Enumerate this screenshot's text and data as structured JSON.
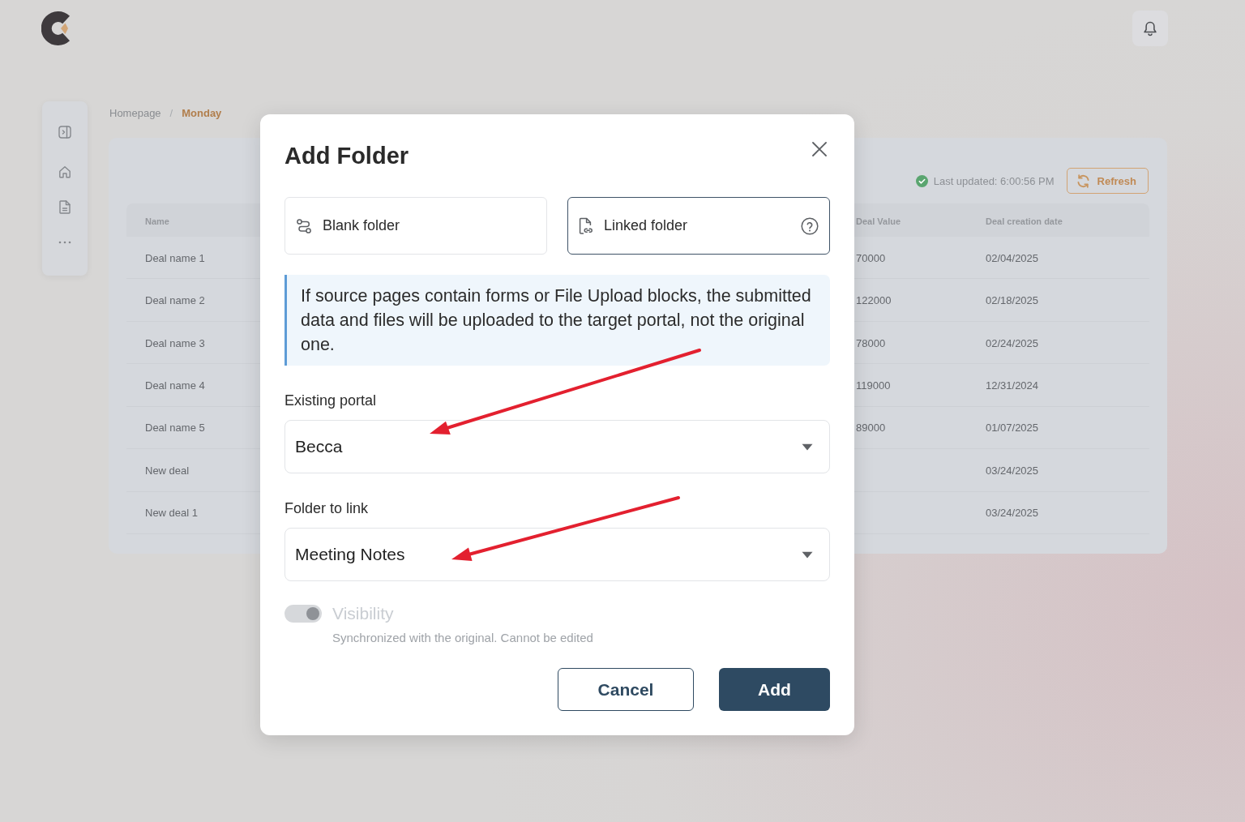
{
  "breadcrumb": {
    "separator": "/",
    "items": [
      {
        "label": "Homepage",
        "selected": false
      },
      {
        "label": "Monday",
        "selected": true
      }
    ]
  },
  "deals": {
    "last_updated": "Last updated: 6:00:56 PM",
    "refresh_button": "Refresh",
    "table": {
      "columns": [
        "Name",
        "Deal Value",
        "Deal creation date"
      ],
      "rows": [
        {
          "name": "Deal name 1",
          "deal_value": "70000",
          "deal_creation_date": "02/04/2025"
        },
        {
          "name": "Deal name 2",
          "deal_value": "122000",
          "deal_creation_date": "02/18/2025"
        },
        {
          "name": "Deal name 3",
          "deal_value": "78000",
          "deal_creation_date": "02/24/2025"
        },
        {
          "name": "Deal name 4",
          "deal_value": "119000",
          "deal_creation_date": "12/31/2024"
        },
        {
          "name": "Deal name 5",
          "deal_value": "89000",
          "deal_creation_date": "01/07/2025"
        },
        {
          "name": "New deal",
          "deal_creation_date": "03/24/2025"
        },
        {
          "name": "New deal 1",
          "deal_creation_date": "03/24/2025"
        }
      ]
    }
  },
  "dialog": {
    "title": "Add Folder",
    "folder_types": [
      {
        "kind": "blank",
        "label": "Blank folder",
        "selected": false,
        "help": false
      },
      {
        "kind": "linked",
        "label": "Linked folder",
        "selected": true,
        "help": true
      }
    ],
    "notice": "If source pages contain forms or File Upload blocks, the submitted data and files will be uploaded to the target portal, not the original one.",
    "fields": [
      {
        "label": "Existing portal",
        "value": "Becca"
      },
      {
        "label": "Folder to link",
        "value": "Meeting Notes"
      }
    ],
    "visibility": {
      "label": "Visibility",
      "on": true,
      "disabled": true,
      "hint": "Synchronized with the original. Cannot be edited"
    },
    "buttons": [
      {
        "kind": "cancel",
        "label": "Cancel"
      },
      {
        "kind": "submit",
        "label": "Add"
      }
    ]
  }
}
